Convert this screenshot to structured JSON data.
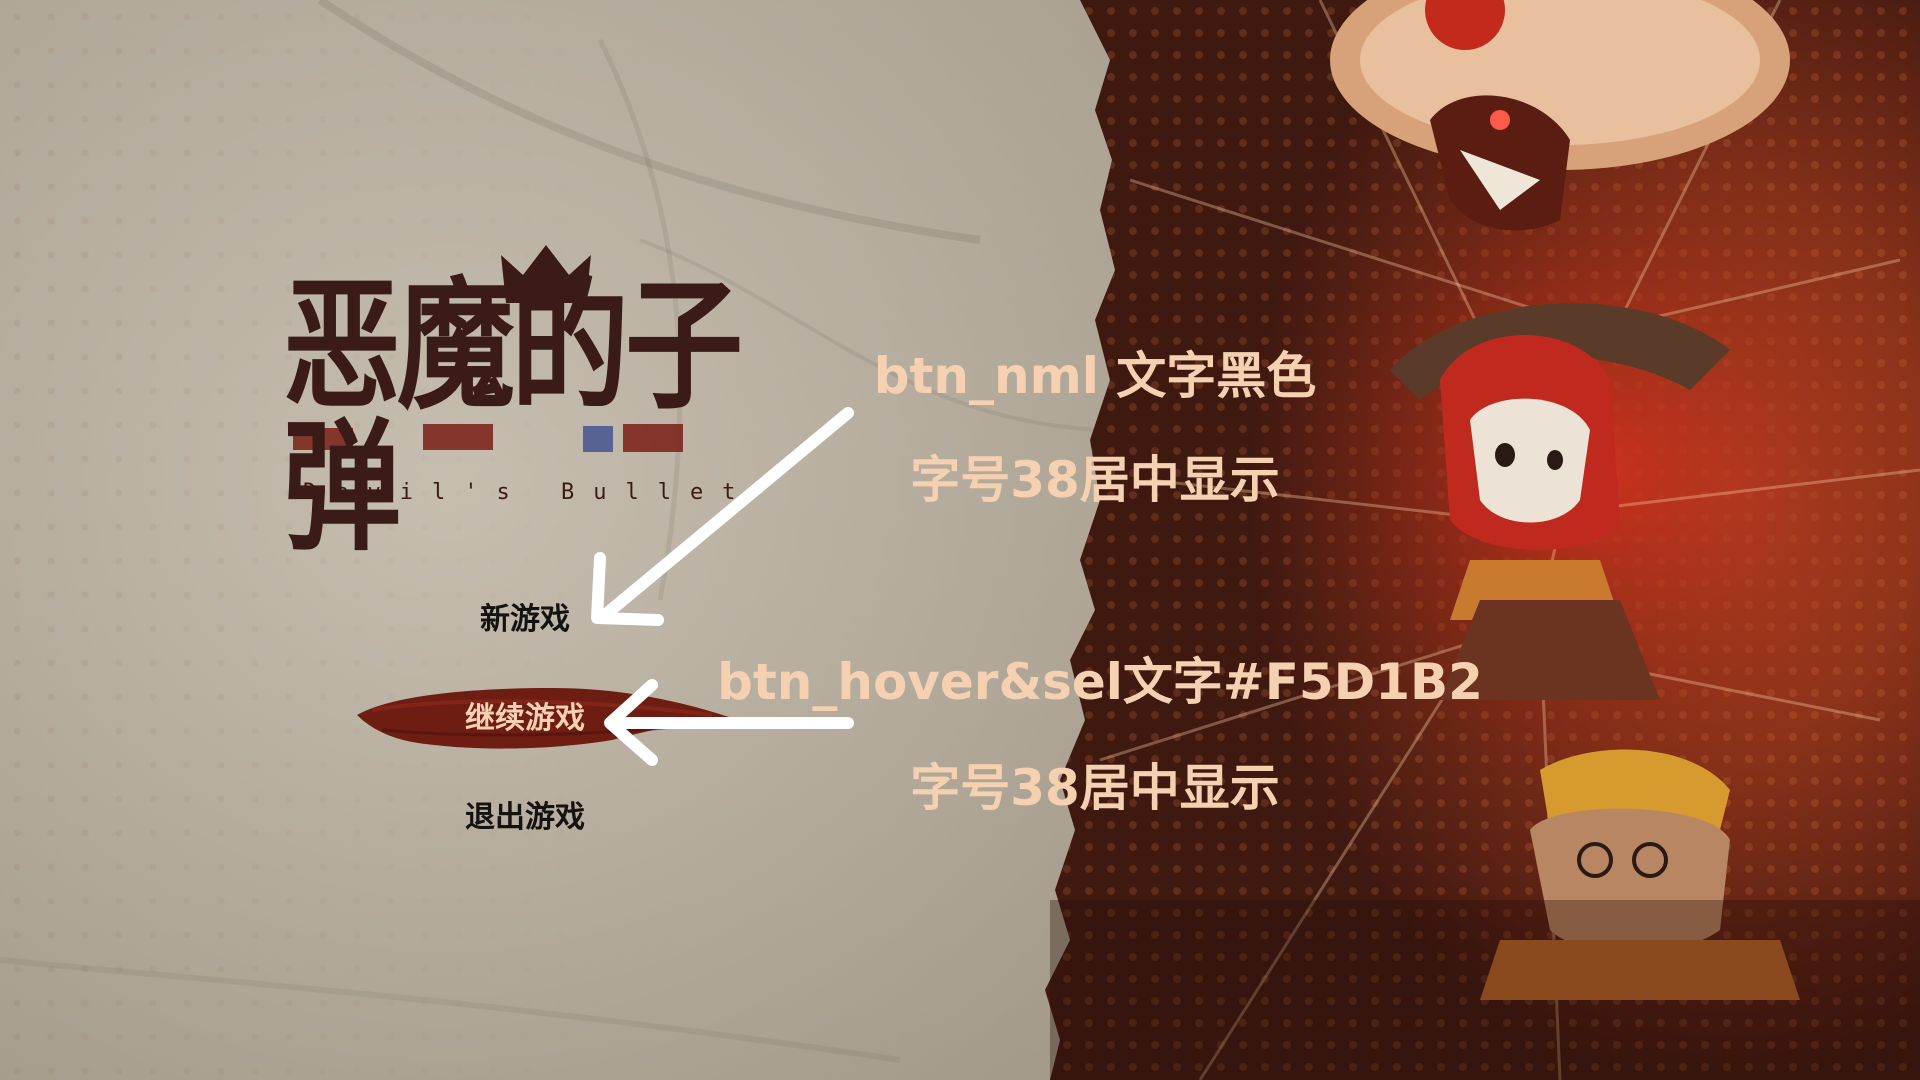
{
  "game": {
    "title_cn": "恶魔的子弹",
    "title_en": "Devil's Bullet"
  },
  "menu": {
    "items": [
      {
        "label": "新游戏",
        "state": "normal"
      },
      {
        "label": "继续游戏",
        "state": "hover"
      },
      {
        "label": "退出游戏",
        "state": "normal"
      }
    ]
  },
  "annotations": {
    "normal": {
      "line1": "btn_nml 文字黑色",
      "line2": "字号38居中显示"
    },
    "hover": {
      "line1": "btn_hover&sel文字#F5D1B2",
      "line2": "字号38居中显示"
    }
  },
  "colors": {
    "text_normal": "#151311",
    "text_hover": "#F5D1B2",
    "brush": "#6e1d12",
    "panel": "#b5ab9d",
    "art_base": "#7a2e17",
    "annotation": "#F5D1B2"
  }
}
